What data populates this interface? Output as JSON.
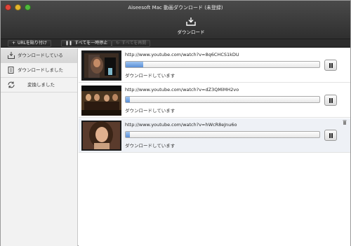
{
  "window": {
    "title": "Aiseesoft Mac 動画ダウンロード (未登録)"
  },
  "tab": {
    "label": "ダウンロード",
    "icon": "download-tray-icon"
  },
  "toolbar": {
    "paste_url": "URLを貼り付け",
    "pause_all": "すべてを一時停止",
    "resume_all": "すべてを再開"
  },
  "sidebar": {
    "items": [
      {
        "label": "ダウンロードしている",
        "icon": "download-icon"
      },
      {
        "label": "ダウンロードしました",
        "icon": "document-icon"
      },
      {
        "label": "変換しました",
        "icon": "convert-icon"
      }
    ]
  },
  "downloads": [
    {
      "url": "http://www.youtube.com/watch?v=8q6CHCS1kDU",
      "status": "ダウンロードしています",
      "progress": 0.09
    },
    {
      "url": "http://www.youtube.com/watch?v=dZ3QMiMH2vo",
      "status": "ダウンロードしています",
      "progress": 0.02
    },
    {
      "url": "http://www.youtube.com/watch?v=hWcR8eJnu6o",
      "status": "ダウンロードしています",
      "progress": 0.02
    }
  ],
  "colors": {
    "titlebar": "#3a3a3a",
    "progress": "#5a8fd6",
    "sidebar_active": "#d9d9d9",
    "selected_row": "#eef1f6"
  }
}
